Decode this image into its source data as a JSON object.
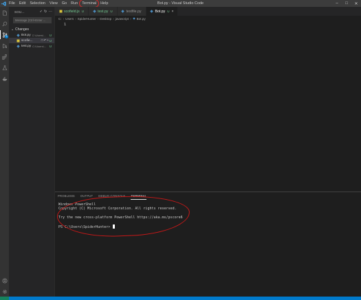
{
  "window": {
    "title": "Bot.py - Visual Studio Code"
  },
  "menu": [
    "File",
    "Edit",
    "Selection",
    "View",
    "Go",
    "Run",
    "Terminal",
    "Help"
  ],
  "sidebar": {
    "title": "SOU...",
    "message_placeholder": "Message (Ctrl+Enter ...",
    "changes_label": "Changes",
    "files": [
      {
        "name": "Bot.py",
        "path": "C:\\Users\\...",
        "status": "U"
      },
      {
        "name": "scofie...",
        "path": "",
        "status": "U"
      },
      {
        "name": "test.py",
        "path": "C:\\Users\\...",
        "status": "U"
      }
    ]
  },
  "tabs": [
    {
      "label": "scofield.js",
      "status": "U"
    },
    {
      "label": "test.py",
      "status": "U"
    },
    {
      "label": "testfile.py",
      "status": ""
    },
    {
      "label": "Bot.py",
      "status": "U"
    }
  ],
  "breadcrumb": [
    "C:",
    "Users",
    "SpiderHunter",
    "Desktop",
    "javascript",
    "Bot.py"
  ],
  "editor": {
    "line_number": "1"
  },
  "panel": {
    "tabs": [
      "PROBLEMS",
      "OUTPUT",
      "DEBUG CONSOLE",
      "TERMINAL"
    ],
    "terminal_lines": [
      "Windows PowerShell",
      "Copyright (C) Microsoft Corporation. All rights reserved.",
      "",
      "Try the new cross-platform PowerShell https://aka.ms/pscore6",
      "",
      "PS C:\\Users\\SpiderHunter> "
    ]
  },
  "icons": {
    "explorer": "files-icon",
    "search": "search-icon",
    "source_control": "source-control-icon",
    "run": "run-debug-icon",
    "extensions": "extensions-icon",
    "testing": "flask-icon",
    "docker": "whale-icon",
    "account": "account-icon",
    "settings": "gear-icon"
  },
  "source_control_badge": "3",
  "colors": {
    "accent": "#007acc",
    "untracked": "#73c991",
    "annotation": "#c81818"
  }
}
